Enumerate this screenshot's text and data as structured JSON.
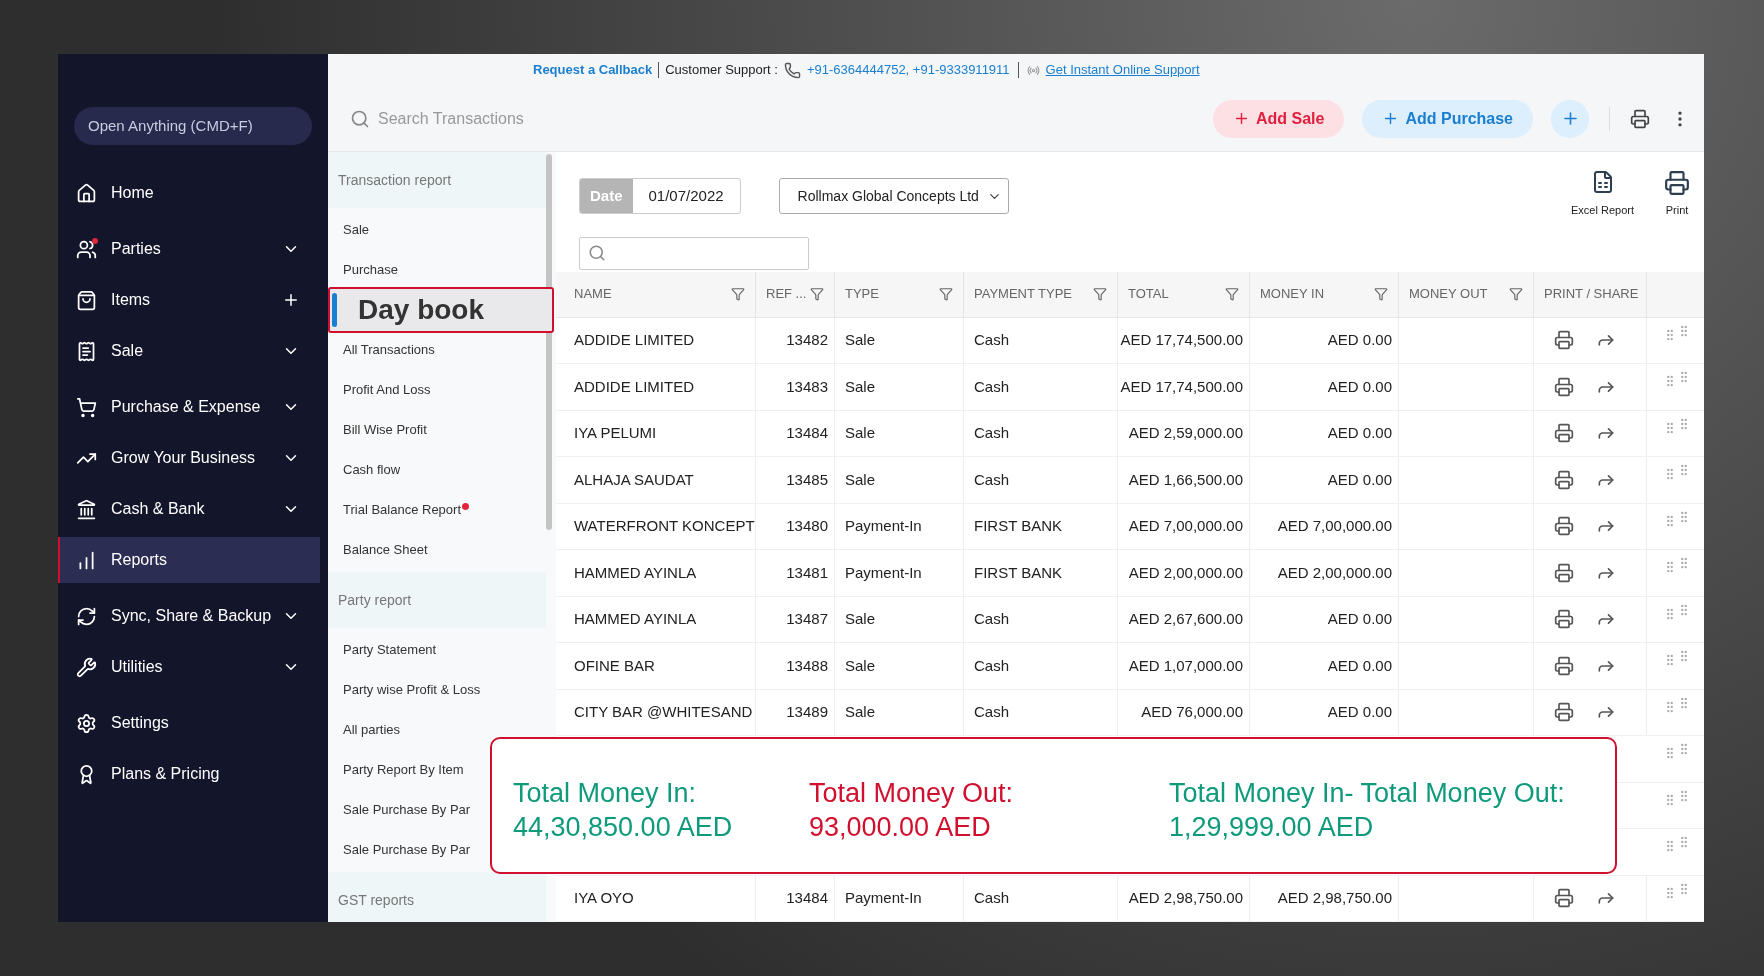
{
  "top_bar": {
    "callback_link": "Request a Callback",
    "support_label": "Customer Support :",
    "phone_numbers": "+91-6364444752, +91-9333911911",
    "online_support_link": "Get Instant Online Support"
  },
  "search": {
    "placeholder": "Search Transactions"
  },
  "actions": [
    {
      "label": "Add Sale",
      "kind": "sale"
    },
    {
      "label": "Add Purchase",
      "kind": "purchase"
    }
  ],
  "sidebar": {
    "search_button": "Open Anything (CMD+F)",
    "items": [
      {
        "label": "Home",
        "kind": "plain",
        "selected": false,
        "notification": false
      },
      {
        "label": "Parties",
        "kind": "expandable",
        "selected": false,
        "notification": true
      },
      {
        "label": "Items",
        "kind": "addable",
        "selected": false,
        "notification": false
      },
      {
        "label": "Sale",
        "kind": "expandable",
        "selected": false,
        "notification": false
      },
      {
        "label": "Purchase & Expense",
        "kind": "expandable",
        "selected": false,
        "notification": false
      },
      {
        "label": "Grow Your Business",
        "kind": "expandable",
        "selected": false,
        "notification": false
      },
      {
        "label": "Cash & Bank",
        "kind": "expandable",
        "selected": false,
        "notification": false
      },
      {
        "label": "Reports",
        "kind": "plain",
        "selected": true,
        "notification": false
      },
      {
        "label": "Sync, Share & Backup",
        "kind": "expandable",
        "selected": false,
        "notification": false
      },
      {
        "label": "Utilities",
        "kind": "expandable",
        "selected": false,
        "notification": false
      },
      {
        "label": "Settings",
        "kind": "plain",
        "selected": false,
        "notification": false
      },
      {
        "label": "Plans & Pricing",
        "kind": "plain",
        "selected": false,
        "notification": false
      }
    ]
  },
  "report_menu": [
    {
      "title": "Transaction report",
      "items": [
        {
          "label": "Sale",
          "selected": false,
          "notification": false
        },
        {
          "label": "Purchase",
          "selected": false,
          "notification": false
        },
        {
          "label": "Day book",
          "selected": true,
          "notification": false
        },
        {
          "label": "All Transactions",
          "selected": false,
          "notification": false
        },
        {
          "label": "Profit And Loss",
          "selected": false,
          "notification": false
        },
        {
          "label": "Bill Wise Profit",
          "selected": false,
          "notification": false
        },
        {
          "label": "Cash flow",
          "selected": false,
          "notification": false
        },
        {
          "label": "Trial Balance Report",
          "selected": false,
          "notification": true
        },
        {
          "label": "Balance Sheet",
          "selected": false,
          "notification": false
        }
      ]
    },
    {
      "title": "Party report",
      "items": [
        {
          "label": "Party Statement",
          "selected": false,
          "notification": false
        },
        {
          "label": "Party wise Profit & Loss",
          "selected": false,
          "notification": false
        },
        {
          "label": "All parties",
          "selected": false,
          "notification": false
        },
        {
          "label": "Party Report By Item",
          "selected": false,
          "notification": false
        },
        {
          "label": "Sale Purchase By Par",
          "selected": false,
          "notification": false
        },
        {
          "label": "Sale Purchase By Par",
          "selected": false,
          "notification": false
        }
      ]
    },
    {
      "title": "GST reports"
    }
  ],
  "filters": {
    "date_label": "Date",
    "date": "01/07/2022",
    "party": "Rollmax Global Concepts Ltd",
    "excel_label": "Excel Report",
    "print_label": "Print"
  },
  "table": {
    "columns": [
      {
        "label": "NAME",
        "filter": true
      },
      {
        "label": "REF ...",
        "filter": true
      },
      {
        "label": "TYPE",
        "filter": true
      },
      {
        "label": "PAYMENT TYPE",
        "filter": true
      },
      {
        "label": "TOTAL",
        "filter": true
      },
      {
        "label": "MONEY IN",
        "filter": true
      },
      {
        "label": "MONEY OUT",
        "filter": true
      },
      {
        "label": "PRINT / SHARE",
        "filter": false
      }
    ],
    "rows": [
      {
        "kind": "entry",
        "cells": [
          "ADDIDE LIMITED",
          "13482",
          "Sale",
          "Cash",
          "AED 17,74,500.00",
          "AED 0.00"
        ]
      },
      {
        "kind": "entry",
        "cells": [
          "ADDIDE LIMITED",
          "13483",
          "Sale",
          "Cash",
          "AED 17,74,500.00",
          "AED 0.00"
        ]
      },
      {
        "kind": "entry",
        "cells": [
          "IYA PELUMI",
          "13484",
          "Sale",
          "Cash",
          "AED 2,59,000.00",
          "AED 0.00"
        ]
      },
      {
        "kind": "entry",
        "cells": [
          "ALHAJA SAUDAT",
          "13485",
          "Sale",
          "Cash",
          "AED 1,66,500.00",
          "AED 0.00"
        ]
      },
      {
        "kind": "entry",
        "cells": [
          "WATERFRONT KONCEPT",
          "13480",
          "Payment-In",
          "FIRST BANK",
          "AED 7,00,000.00",
          "AED 7,00,000.00"
        ]
      },
      {
        "kind": "entry",
        "cells": [
          "HAMMED AYINLA",
          "13481",
          "Payment-In",
          "FIRST BANK",
          "AED 2,00,000.00",
          "AED 2,00,000.00"
        ]
      },
      {
        "kind": "entry",
        "cells": [
          "HAMMED AYINLA",
          "13487",
          "Sale",
          "Cash",
          "AED 2,67,600.00",
          "AED 0.00"
        ]
      },
      {
        "kind": "entry",
        "cells": [
          "OFINE BAR",
          "13488",
          "Sale",
          "Cash",
          "AED 1,07,000.00",
          "AED 0.00"
        ]
      },
      {
        "kind": "entry",
        "cells": [
          "CITY BAR @WHITESAND",
          "13489",
          "Sale",
          "Cash",
          "AED 76,000.00",
          "AED 0.00"
        ]
      },
      {
        "kind": "covered"
      },
      {
        "kind": "covered"
      },
      {
        "kind": "covered"
      },
      {
        "kind": "entry",
        "cells": [
          "IYA OYO",
          "13484",
          "Payment-In",
          "Cash",
          "AED 2,98,750.00",
          "AED 2,98,750.00"
        ]
      }
    ]
  },
  "summary": [
    {
      "label": "Total Money In:",
      "value": "44,30,850.00 AED",
      "kind": "positive"
    },
    {
      "label": "Total Money Out:",
      "value": "93,000.00 AED",
      "kind": "negative"
    },
    {
      "label": "Total Money In- Total Money Out:",
      "value": "1,29,999.00 AED",
      "kind": "positive"
    }
  ]
}
